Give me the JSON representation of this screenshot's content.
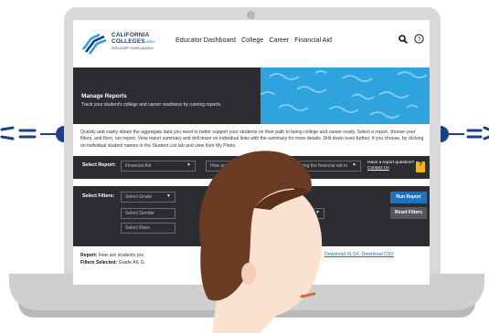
{
  "header": {
    "logo_line1": "CALIFORNIA",
    "logo_line2": "COLLEGES",
    "logo_suffix": ".edu",
    "logo_tagline": "DISCOVER YOUR LAUNCH",
    "nav": [
      "Educator Dashboard",
      "College",
      "Career",
      "Financial Aid"
    ]
  },
  "banner": {
    "title": "Manage Reports",
    "subtitle": "Track your student's college and career readiness by running reports."
  },
  "intro": "Quickly and easily obtain the aggregate data you need to better support your students on their path to being college and career ready. Select a report, choose your filters, and then, run report. View report summary and drill down on individual links with the summary for more details. Drill down even further, if you choose, by clicking on individual student names in the Student List tab and view their My Plans.",
  "report": {
    "label": "Select Report:",
    "selected": "Financial Aid",
    "question_value": "How are students progressing toward completing the financial aid m",
    "help_text": "Have a report question?",
    "contact_link": "Contact Us",
    "help_badge": "?"
  },
  "filters": {
    "label": "Select Filters:",
    "grade_placeholder": "Select Grade",
    "gender_placeholder": "Select Gender",
    "race_placeholder": "Select Race",
    "run_button": "Run Report",
    "reset_button": "Reset Filters"
  },
  "summary": {
    "report_label": "Report:",
    "report_text": "How are students pro",
    "filters_label": "Filters Selected:",
    "filters_text": "Grade All, G",
    "download_xlsx": "Download XLSX",
    "download_csv": "Download CSV"
  },
  "colors": {
    "dark_panel": "#2c2d31",
    "accent_blue": "#1e73be",
    "banner_blue": "#2fa3dd",
    "badge_yellow": "#f2b71b"
  }
}
